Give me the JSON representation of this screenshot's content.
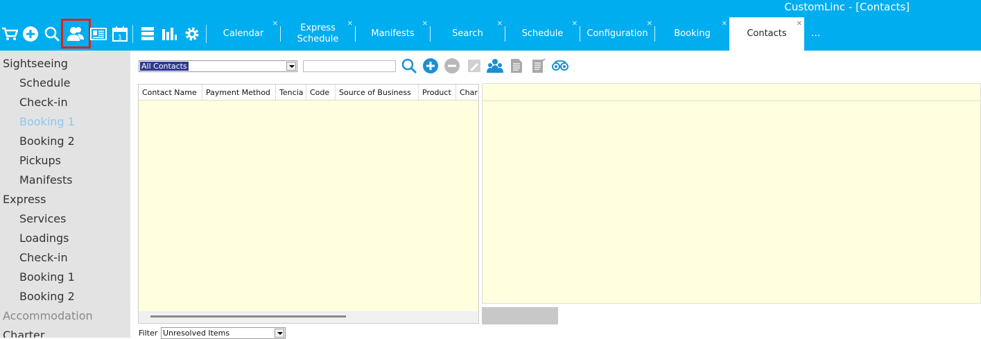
{
  "window": {
    "title": "CustomLinc - [Contacts]"
  },
  "toolbar": {
    "icons": [
      "cart-icon",
      "add-icon",
      "search-icon",
      "contacts-icon",
      "id-card-icon",
      "calendar-icon",
      "server-icon",
      "bar-chart-icon",
      "gear-icon"
    ],
    "highlight_color": "#e0201b"
  },
  "tabs": [
    {
      "label": "Calendar",
      "closable": true
    },
    {
      "label": "Express\nSchedule",
      "closable": true
    },
    {
      "label": "Manifests",
      "closable": true
    },
    {
      "label": "Search",
      "closable": true
    },
    {
      "label": "Schedule",
      "closable": true
    },
    {
      "label": "Configuration",
      "closable": true
    },
    {
      "label": "Booking",
      "closable": true
    },
    {
      "label": "Contacts",
      "closable": true,
      "active": true
    }
  ],
  "tabs_more": "...",
  "sidebar": {
    "items": [
      {
        "label": "Sightseeing",
        "level": "group"
      },
      {
        "label": "Schedule",
        "level": "sub"
      },
      {
        "label": "Check-in",
        "level": "sub"
      },
      {
        "label": "Booking 1",
        "level": "sub",
        "active": true
      },
      {
        "label": "Booking 2",
        "level": "sub"
      },
      {
        "label": "Pickups",
        "level": "sub"
      },
      {
        "label": "Manifests",
        "level": "sub"
      },
      {
        "label": "Express",
        "level": "group"
      },
      {
        "label": "Services",
        "level": "sub"
      },
      {
        "label": "Loadings",
        "level": "sub"
      },
      {
        "label": "Check-in",
        "level": "sub"
      },
      {
        "label": "Booking 1",
        "level": "sub"
      },
      {
        "label": "Booking 2",
        "level": "sub"
      },
      {
        "label": "Accommodation",
        "level": "group",
        "dim": true
      },
      {
        "label": "Charter",
        "level": "group"
      }
    ]
  },
  "contacts": {
    "selector_value": "All Contacts",
    "search_value": "",
    "actions": [
      "search-icon",
      "add-icon",
      "remove-icon",
      "edit-icon",
      "contacts-icon",
      "document-icon",
      "notes-icon",
      "tripadvisor-icon"
    ],
    "columns": [
      "Contact Name",
      "Payment Method",
      "Tencia",
      "Code",
      "Source of Business",
      "Product",
      "Char"
    ],
    "rows": []
  },
  "filter": {
    "label": "Filter",
    "value": "Unresolved Items"
  },
  "colors": {
    "accent": "#00adef",
    "grid_bg": "#ffffe0",
    "sidebar_bg": "#e3e3e3",
    "selected_blue": "#2f3b8f"
  }
}
